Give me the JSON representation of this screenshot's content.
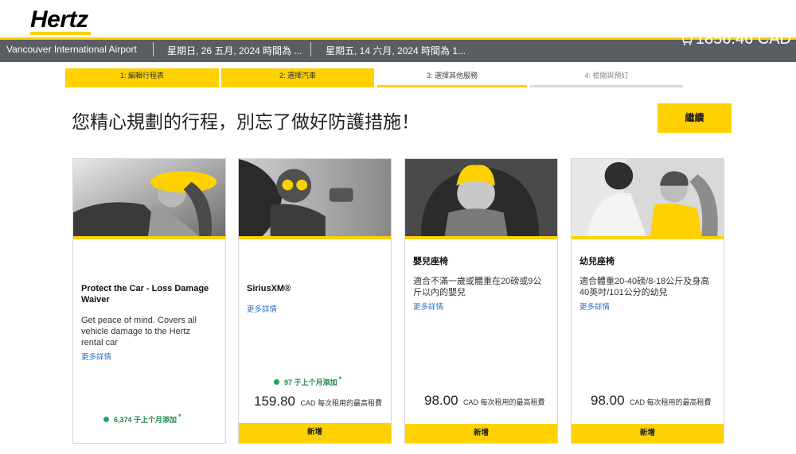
{
  "brand": {
    "logo": "Hertz",
    "accent": "#ffd100"
  },
  "trip": {
    "location": "Vancouver International Airport",
    "pickup": "星期日, 26 五月, 2024 時間為 ...",
    "return": "星期五, 14 六月, 2024 時間為 1...",
    "cart_total": "1856.46 CAD"
  },
  "steps": [
    {
      "label": "1:  編輯行程表",
      "state": "done"
    },
    {
      "label": "2:  選擇汽車",
      "state": "done"
    },
    {
      "label": "3:  選擇其他服務",
      "state": "current"
    },
    {
      "label": "4:  檢閱與預訂",
      "state": "todo"
    }
  ],
  "page": {
    "title": "您精心規劃的行程，別忘了做好防護措施！",
    "continue_label": "繼續"
  },
  "cards": [
    {
      "title": "Protect the Car - Loss Damage Waiver",
      "desc": "Get peace of mind. Covers all vehicle damage to the Hertz rental car",
      "link": "更多詳情",
      "trend": "6,374 于上个月添加",
      "star": "*",
      "price": "",
      "unit": "",
      "add": ""
    },
    {
      "title": "SiriusXM®",
      "desc": "",
      "link": "更多詳情",
      "trend": "97 于上个月添加",
      "star": "*",
      "price": "159.80",
      "unit": "CAD 每次租用的最高租費",
      "add": "新增"
    },
    {
      "title": "嬰兒座椅",
      "desc": "適合不滿一歲或體重在20磅或9公斤以內的嬰兒",
      "link": "更多詳情",
      "trend": "",
      "star": "",
      "price": "98.00",
      "unit": "CAD 每次租用的最高租費",
      "add": "新增"
    },
    {
      "title": "幼兒座椅",
      "desc": "適合體重20-40磅/8-18公斤及身高40英吋/101公分的幼兒",
      "link": "更多詳情",
      "trend": "",
      "star": "",
      "price": "98.00",
      "unit": "CAD 每次租用的最高租費",
      "add": "新增"
    }
  ]
}
